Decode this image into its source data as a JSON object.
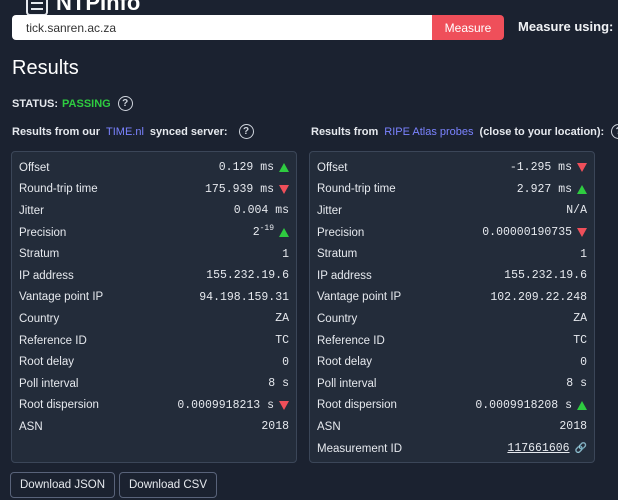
{
  "header": {
    "brand": "NTPInfo",
    "search_value": "tick.sanren.ac.za",
    "measure_label": "Measure",
    "measure_using_label": "Measure using:"
  },
  "results": {
    "title": "Results",
    "status_label": "STATUS:",
    "status_value": "PASSING",
    "status_color": "#2ecc40"
  },
  "left": {
    "heading_prefix": "Results from our",
    "heading_link": "TIME.nl",
    "heading_suffix": "synced server:",
    "rows": [
      {
        "label": "Offset",
        "value": "0.129 ms",
        "arrow": "up"
      },
      {
        "label": "Round-trip time",
        "value": "175.939 ms",
        "arrow": "down"
      },
      {
        "label": "Jitter",
        "value": "0.004 ms"
      },
      {
        "label": "Precision",
        "value_base": "2",
        "value_exp": "-19",
        "arrow": "up"
      },
      {
        "label": "Stratum",
        "value": "1"
      },
      {
        "label": "IP address",
        "value": "155.232.19.6"
      },
      {
        "label": "Vantage point IP",
        "value": "94.198.159.31"
      },
      {
        "label": "Country",
        "value": "ZA"
      },
      {
        "label": "Reference ID",
        "value": "TC"
      },
      {
        "label": "Root delay",
        "value": "0"
      },
      {
        "label": "Poll interval",
        "value": "8 s"
      },
      {
        "label": "Root dispersion",
        "value": "0.0009918213 s",
        "arrow": "down"
      },
      {
        "label": "ASN",
        "value": "2018"
      }
    ]
  },
  "right": {
    "heading_prefix": "Results from",
    "heading_link": "RIPE Atlas probes",
    "heading_suffix": "(close to your location):",
    "rows": [
      {
        "label": "Offset",
        "value": "-1.295 ms",
        "arrow": "down"
      },
      {
        "label": "Round-trip time",
        "value": "2.927 ms",
        "arrow": "up"
      },
      {
        "label": "Jitter",
        "value": "N/A"
      },
      {
        "label": "Precision",
        "value": "0.00000190735",
        "arrow": "down"
      },
      {
        "label": "Stratum",
        "value": "1"
      },
      {
        "label": "IP address",
        "value": "155.232.19.6"
      },
      {
        "label": "Vantage point IP",
        "value": "102.209.22.248"
      },
      {
        "label": "Country",
        "value": "ZA"
      },
      {
        "label": "Reference ID",
        "value": "TC"
      },
      {
        "label": "Root delay",
        "value": "0"
      },
      {
        "label": "Poll interval",
        "value": "8 s"
      },
      {
        "label": "Root dispersion",
        "value": "0.0009918208 s",
        "arrow": "up"
      },
      {
        "label": "ASN",
        "value": "2018"
      },
      {
        "label": "Measurement ID",
        "value": "117661606",
        "link": true
      }
    ]
  },
  "downloads": {
    "json_label": "Download JSON",
    "csv_label": "Download CSV"
  },
  "icons": {
    "logo": "server-stack-icon",
    "help": "question-circle-icon",
    "link": "chain-link-icon",
    "up": "triangle-up-icon",
    "down": "triangle-down-icon"
  },
  "colors": {
    "background": "#1b2230",
    "panel": "#232c3a",
    "accent_red": "#ef4f5a",
    "accent_green": "#2ecc40",
    "link_blue": "#7b83ff"
  }
}
